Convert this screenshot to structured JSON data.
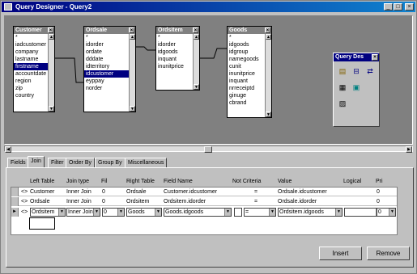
{
  "window": {
    "title": "Query Designer - Query2",
    "min": "_",
    "max": "□",
    "close": "×"
  },
  "tables": [
    {
      "name": "Customer",
      "fields": [
        "*",
        "iadcustomer",
        "company",
        "lastname",
        "firstname",
        "accountdate",
        "region",
        "zip",
        "country"
      ],
      "selected": 4
    },
    {
      "name": "Ordsale",
      "fields": [
        "*",
        "idorder",
        "ordate",
        "dddate",
        "idterritory",
        "idcustomer",
        "eyppay",
        "norder"
      ],
      "selected": 5
    },
    {
      "name": "Ordsitem",
      "fields": [
        "*",
        "idorder",
        "idgoods",
        "inquant",
        "inunitprice"
      ],
      "selected": -1
    },
    {
      "name": "Goods",
      "fields": [
        "*",
        "idgoods",
        "idgroup",
        "namegoods",
        "cunit",
        "inunitprice",
        "inquant",
        "nrreceiptd",
        "ginuge",
        "cbrand"
      ],
      "selected": -1
    }
  ],
  "toolbox": {
    "title": "Query Des"
  },
  "tabs": [
    "Fields",
    "Join",
    "Filter",
    "Order By",
    "Group By",
    "Miscellaneous"
  ],
  "columns": [
    "Left Table",
    "Join type",
    "Fil",
    "Right Table",
    "Field Name",
    "Not Criteria",
    "Value",
    "Logical",
    "Pri"
  ],
  "rows": [
    {
      "marker": "<>",
      "left": "Customer",
      "jtype": "Inner Join",
      "fil": "0",
      "right": "Ordsale",
      "field": "Customer.idcustomer",
      "not": "=",
      "value": "Ordsale.idcustomer",
      "logical": "",
      "pri": "0"
    },
    {
      "marker": "<>",
      "left": "Ordsale",
      "jtype": "Inner Join",
      "fil": "0",
      "right": "Ordsitem",
      "field": "Ordsitem.idorder",
      "not": "=",
      "value": "Ordsale.idorder",
      "logical": "",
      "pri": "0"
    },
    {
      "marker": "<>",
      "left": "Ordsitem",
      "jtype": "Inner Join",
      "fil": "0",
      "right": "Goods",
      "field": "Goods.idgoods",
      "not": "=",
      "value": "Ordsitem.idgoods",
      "logical": "",
      "pri": "0"
    }
  ],
  "buttons": {
    "insert": "Insert",
    "remove": "Remove"
  }
}
